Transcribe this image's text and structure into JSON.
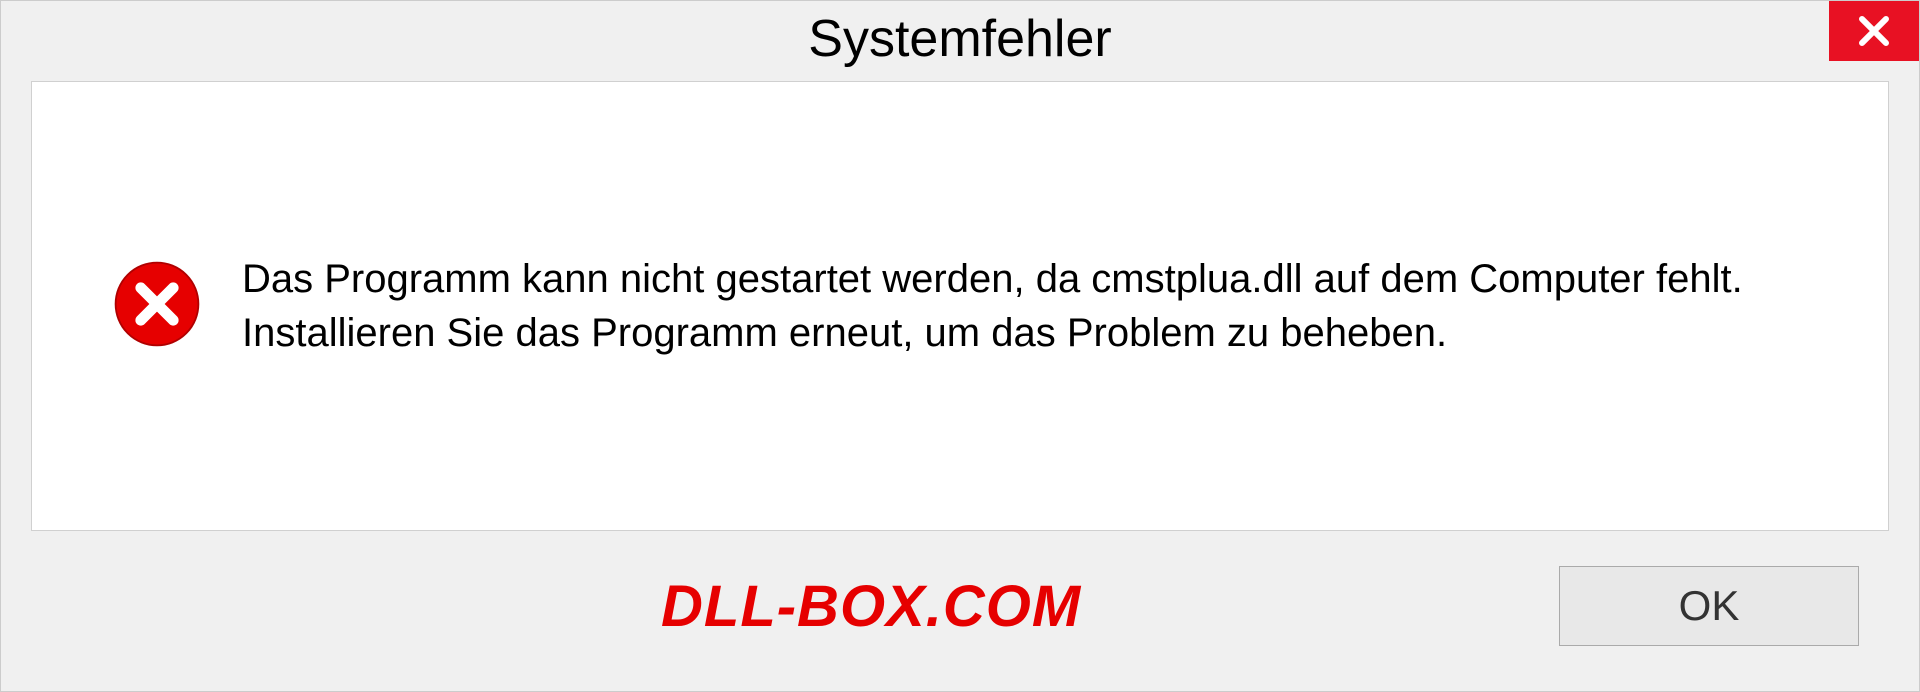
{
  "dialog": {
    "title": "Systemfehler",
    "message": "Das Programm kann nicht gestartet werden, da cmstplua.dll auf dem Computer fehlt. Installieren Sie das Programm erneut, um das Problem zu beheben.",
    "ok_label": "OK"
  },
  "watermark": "DLL-BOX.COM"
}
